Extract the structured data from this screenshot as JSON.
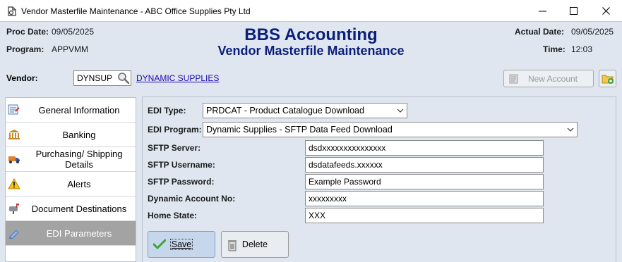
{
  "window": {
    "title": "Vendor Masterfile Maintenance - ABC Office Supplies Pty Ltd"
  },
  "header": {
    "proc_date_label": "Proc Date:",
    "proc_date_value": "09/05/2025",
    "program_label": "Program:",
    "program_value": "APPVMM",
    "brand_title": "BBS Accounting",
    "brand_subtitle": "Vendor Masterfile Maintenance",
    "actual_date_label": "Actual Date:",
    "actual_date_value": "09/05/2025",
    "time_label": "Time:",
    "time_value": "12:03"
  },
  "vendor": {
    "label": "Vendor:",
    "code": "DYNSUP",
    "name": "DYNAMIC SUPPLIES",
    "new_account_label": "New Account"
  },
  "sidebar": {
    "items": [
      {
        "label": "General Information",
        "icon": "form-icon"
      },
      {
        "label": "Banking",
        "icon": "bank-icon"
      },
      {
        "label": "Purchasing/ Shipping Details",
        "icon": "truck-icon"
      },
      {
        "label": "Alerts",
        "icon": "warning-icon"
      },
      {
        "label": "Document Destinations",
        "icon": "mailbox-icon"
      },
      {
        "label": "EDI Parameters",
        "icon": "pencil-icon",
        "active": true
      }
    ]
  },
  "edi": {
    "type_label": "EDI Type:",
    "type_value": "PRDCAT - Product Catalogue Download",
    "program_label": "EDI Program:",
    "program_value": "Dynamic Supplies - SFTP Data Feed Download",
    "fields": [
      {
        "label": "SFTP Server:",
        "value": "dsdxxxxxxxxxxxxxxx"
      },
      {
        "label": "SFTP Username:",
        "value": "dsdatafeeds.xxxxxx"
      },
      {
        "label": "SFTP Password:",
        "value": "Example Password"
      },
      {
        "label": "Dynamic Account No:",
        "value": "xxxxxxxxx"
      },
      {
        "label": "Home State:",
        "value": "XXX"
      }
    ]
  },
  "actions": {
    "save_label": "Save",
    "delete_label": "Delete"
  },
  "colors": {
    "brand": "#0b1f7a",
    "background": "#dfe6f0",
    "active_nav": "#a3a3a3",
    "link": "#1a0dab"
  }
}
